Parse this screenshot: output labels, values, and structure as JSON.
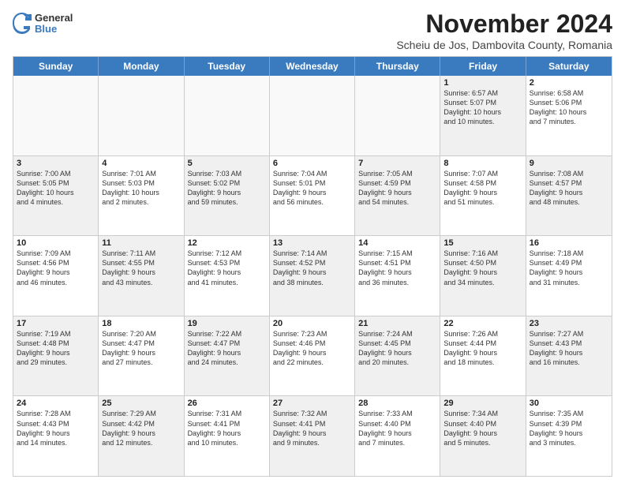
{
  "header": {
    "logo": {
      "general": "General",
      "blue": "Blue"
    },
    "title": "November 2024",
    "subtitle": "Scheiu de Jos, Dambovita County, Romania"
  },
  "calendar": {
    "weekdays": [
      "Sunday",
      "Monday",
      "Tuesday",
      "Wednesday",
      "Thursday",
      "Friday",
      "Saturday"
    ],
    "rows": [
      {
        "cells": [
          {
            "day": "",
            "empty": true
          },
          {
            "day": "",
            "empty": true
          },
          {
            "day": "",
            "empty": true
          },
          {
            "day": "",
            "empty": true
          },
          {
            "day": "",
            "empty": true
          },
          {
            "day": "1",
            "shaded": true,
            "lines": [
              "Sunrise: 6:57 AM",
              "Sunset: 5:07 PM",
              "Daylight: 10 hours",
              "and 10 minutes."
            ]
          },
          {
            "day": "2",
            "shaded": false,
            "lines": [
              "Sunrise: 6:58 AM",
              "Sunset: 5:06 PM",
              "Daylight: 10 hours",
              "and 7 minutes."
            ]
          }
        ]
      },
      {
        "cells": [
          {
            "day": "3",
            "shaded": true,
            "lines": [
              "Sunrise: 7:00 AM",
              "Sunset: 5:05 PM",
              "Daylight: 10 hours",
              "and 4 minutes."
            ]
          },
          {
            "day": "4",
            "shaded": false,
            "lines": [
              "Sunrise: 7:01 AM",
              "Sunset: 5:03 PM",
              "Daylight: 10 hours",
              "and 2 minutes."
            ]
          },
          {
            "day": "5",
            "shaded": true,
            "lines": [
              "Sunrise: 7:03 AM",
              "Sunset: 5:02 PM",
              "Daylight: 9 hours",
              "and 59 minutes."
            ]
          },
          {
            "day": "6",
            "shaded": false,
            "lines": [
              "Sunrise: 7:04 AM",
              "Sunset: 5:01 PM",
              "Daylight: 9 hours",
              "and 56 minutes."
            ]
          },
          {
            "day": "7",
            "shaded": true,
            "lines": [
              "Sunrise: 7:05 AM",
              "Sunset: 4:59 PM",
              "Daylight: 9 hours",
              "and 54 minutes."
            ]
          },
          {
            "day": "8",
            "shaded": false,
            "lines": [
              "Sunrise: 7:07 AM",
              "Sunset: 4:58 PM",
              "Daylight: 9 hours",
              "and 51 minutes."
            ]
          },
          {
            "day": "9",
            "shaded": true,
            "lines": [
              "Sunrise: 7:08 AM",
              "Sunset: 4:57 PM",
              "Daylight: 9 hours",
              "and 48 minutes."
            ]
          }
        ]
      },
      {
        "cells": [
          {
            "day": "10",
            "shaded": false,
            "lines": [
              "Sunrise: 7:09 AM",
              "Sunset: 4:56 PM",
              "Daylight: 9 hours",
              "and 46 minutes."
            ]
          },
          {
            "day": "11",
            "shaded": true,
            "lines": [
              "Sunrise: 7:11 AM",
              "Sunset: 4:55 PM",
              "Daylight: 9 hours",
              "and 43 minutes."
            ]
          },
          {
            "day": "12",
            "shaded": false,
            "lines": [
              "Sunrise: 7:12 AM",
              "Sunset: 4:53 PM",
              "Daylight: 9 hours",
              "and 41 minutes."
            ]
          },
          {
            "day": "13",
            "shaded": true,
            "lines": [
              "Sunrise: 7:14 AM",
              "Sunset: 4:52 PM",
              "Daylight: 9 hours",
              "and 38 minutes."
            ]
          },
          {
            "day": "14",
            "shaded": false,
            "lines": [
              "Sunrise: 7:15 AM",
              "Sunset: 4:51 PM",
              "Daylight: 9 hours",
              "and 36 minutes."
            ]
          },
          {
            "day": "15",
            "shaded": true,
            "lines": [
              "Sunrise: 7:16 AM",
              "Sunset: 4:50 PM",
              "Daylight: 9 hours",
              "and 34 minutes."
            ]
          },
          {
            "day": "16",
            "shaded": false,
            "lines": [
              "Sunrise: 7:18 AM",
              "Sunset: 4:49 PM",
              "Daylight: 9 hours",
              "and 31 minutes."
            ]
          }
        ]
      },
      {
        "cells": [
          {
            "day": "17",
            "shaded": true,
            "lines": [
              "Sunrise: 7:19 AM",
              "Sunset: 4:48 PM",
              "Daylight: 9 hours",
              "and 29 minutes."
            ]
          },
          {
            "day": "18",
            "shaded": false,
            "lines": [
              "Sunrise: 7:20 AM",
              "Sunset: 4:47 PM",
              "Daylight: 9 hours",
              "and 27 minutes."
            ]
          },
          {
            "day": "19",
            "shaded": true,
            "lines": [
              "Sunrise: 7:22 AM",
              "Sunset: 4:47 PM",
              "Daylight: 9 hours",
              "and 24 minutes."
            ]
          },
          {
            "day": "20",
            "shaded": false,
            "lines": [
              "Sunrise: 7:23 AM",
              "Sunset: 4:46 PM",
              "Daylight: 9 hours",
              "and 22 minutes."
            ]
          },
          {
            "day": "21",
            "shaded": true,
            "lines": [
              "Sunrise: 7:24 AM",
              "Sunset: 4:45 PM",
              "Daylight: 9 hours",
              "and 20 minutes."
            ]
          },
          {
            "day": "22",
            "shaded": false,
            "lines": [
              "Sunrise: 7:26 AM",
              "Sunset: 4:44 PM",
              "Daylight: 9 hours",
              "and 18 minutes."
            ]
          },
          {
            "day": "23",
            "shaded": true,
            "lines": [
              "Sunrise: 7:27 AM",
              "Sunset: 4:43 PM",
              "Daylight: 9 hours",
              "and 16 minutes."
            ]
          }
        ]
      },
      {
        "cells": [
          {
            "day": "24",
            "shaded": false,
            "lines": [
              "Sunrise: 7:28 AM",
              "Sunset: 4:43 PM",
              "Daylight: 9 hours",
              "and 14 minutes."
            ]
          },
          {
            "day": "25",
            "shaded": true,
            "lines": [
              "Sunrise: 7:29 AM",
              "Sunset: 4:42 PM",
              "Daylight: 9 hours",
              "and 12 minutes."
            ]
          },
          {
            "day": "26",
            "shaded": false,
            "lines": [
              "Sunrise: 7:31 AM",
              "Sunset: 4:41 PM",
              "Daylight: 9 hours",
              "and 10 minutes."
            ]
          },
          {
            "day": "27",
            "shaded": true,
            "lines": [
              "Sunrise: 7:32 AM",
              "Sunset: 4:41 PM",
              "Daylight: 9 hours",
              "and 9 minutes."
            ]
          },
          {
            "day": "28",
            "shaded": false,
            "lines": [
              "Sunrise: 7:33 AM",
              "Sunset: 4:40 PM",
              "Daylight: 9 hours",
              "and 7 minutes."
            ]
          },
          {
            "day": "29",
            "shaded": true,
            "lines": [
              "Sunrise: 7:34 AM",
              "Sunset: 4:40 PM",
              "Daylight: 9 hours",
              "and 5 minutes."
            ]
          },
          {
            "day": "30",
            "shaded": false,
            "lines": [
              "Sunrise: 7:35 AM",
              "Sunset: 4:39 PM",
              "Daylight: 9 hours",
              "and 3 minutes."
            ]
          }
        ]
      }
    ]
  }
}
